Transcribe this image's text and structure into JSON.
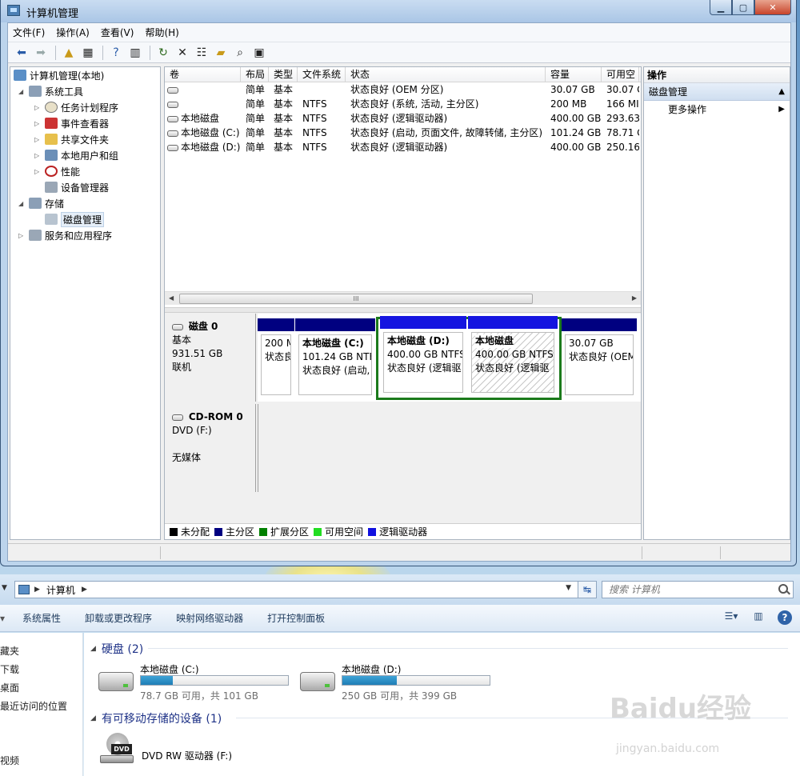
{
  "window": {
    "title": "计算机管理",
    "controls": {
      "minimize": "▁",
      "maximize": "▢",
      "close": "✕"
    }
  },
  "menu": [
    "文件(F)",
    "操作(A)",
    "查看(V)",
    "帮助(H)"
  ],
  "tree": {
    "root": "计算机管理(本地)",
    "system_tools": "系统工具",
    "task_scheduler": "任务计划程序",
    "event_viewer": "事件查看器",
    "shared_folders": "共享文件夹",
    "local_users": "本地用户和组",
    "performance": "性能",
    "device_manager": "设备管理器",
    "storage": "存储",
    "disk_management": "磁盘管理",
    "services": "服务和应用程序"
  },
  "volume_list": {
    "columns": [
      "卷",
      "布局",
      "类型",
      "文件系统",
      "状态",
      "容量",
      "可用空"
    ],
    "rows": [
      [
        "",
        "简单",
        "基本",
        "",
        "状态良好 (OEM 分区)",
        "30.07 GB",
        "30.07 G"
      ],
      [
        "",
        "简单",
        "基本",
        "NTFS",
        "状态良好 (系统, 活动, 主分区)",
        "200 MB",
        "166 MI"
      ],
      [
        "本地磁盘",
        "简单",
        "基本",
        "NTFS",
        "状态良好 (逻辑驱动器)",
        "400.00 GB",
        "293.63"
      ],
      [
        "本地磁盘 (C:)",
        "简单",
        "基本",
        "NTFS",
        "状态良好 (启动, 页面文件, 故障转储, 主分区)",
        "101.24 GB",
        "78.71 G"
      ],
      [
        "本地磁盘 (D:)",
        "简单",
        "基本",
        "NTFS",
        "状态良好 (逻辑驱动器)",
        "400.00 GB",
        "250.16"
      ]
    ],
    "scroll_thumb": "III"
  },
  "disk0": {
    "name": "磁盘 0",
    "type": "基本",
    "size": "931.51 GB",
    "status": "联机",
    "partitions": [
      {
        "title": "",
        "line1": "200 M",
        "line2": "状态良"
      },
      {
        "title": "本地磁盘  (C:)",
        "line1": "101.24 GB NTF",
        "line2": "状态良好 (启动,"
      },
      {
        "title": "本地磁盘  (D:)",
        "line1": "400.00 GB NTFS",
        "line2": "状态良好 (逻辑驱"
      },
      {
        "title": "本地磁盘",
        "line1": "400.00 GB NTFS",
        "line2": "状态良好 (逻辑驱"
      },
      {
        "title": "",
        "line1": "30.07 GB",
        "line2": "状态良好 (OEM"
      }
    ]
  },
  "cdrom0": {
    "name": "CD-ROM 0",
    "drive": "DVD (F:)",
    "media": "无媒体"
  },
  "legend": [
    {
      "label": "未分配",
      "color": "#000000"
    },
    {
      "label": "主分区",
      "color": "#000080"
    },
    {
      "label": "扩展分区",
      "color": "#008000"
    },
    {
      "label": "可用空间",
      "color": "#22dd22"
    },
    {
      "label": "逻辑驱动器",
      "color": "#1010e0"
    }
  ],
  "colors": {
    "primary": "#000080",
    "logical": "#1515e0",
    "selection": "#1b7a1b"
  },
  "actions": {
    "header": "操作",
    "section": "磁盘管理",
    "more": "更多操作"
  },
  "explorer": {
    "address": "计算机",
    "search_placeholder": "搜索 计算机",
    "commands": [
      "系统属性",
      "卸载或更改程序",
      "映射网络驱动器",
      "打开控制面板"
    ],
    "nav": [
      "藏夹",
      "下载",
      "桌面",
      "最近访问的位置",
      "视频"
    ],
    "hard_disks_group": "硬盘 (2)",
    "drives": [
      {
        "name": "本地磁盘 (C:)",
        "free": "78.7 GB 可用，共 101 GB",
        "used_fraction": 0.22
      },
      {
        "name": "本地磁盘 (D:)",
        "free": "250 GB 可用，共 399 GB",
        "used_fraction": 0.37
      }
    ],
    "removable_group": "有可移动存储的设备 (1)",
    "dvd_name": "DVD RW 驱动器 (F:)",
    "dvd_badge": "DVD"
  },
  "watermark": {
    "logo": "Baidu经验",
    "url": "jingyan.baidu.com"
  }
}
